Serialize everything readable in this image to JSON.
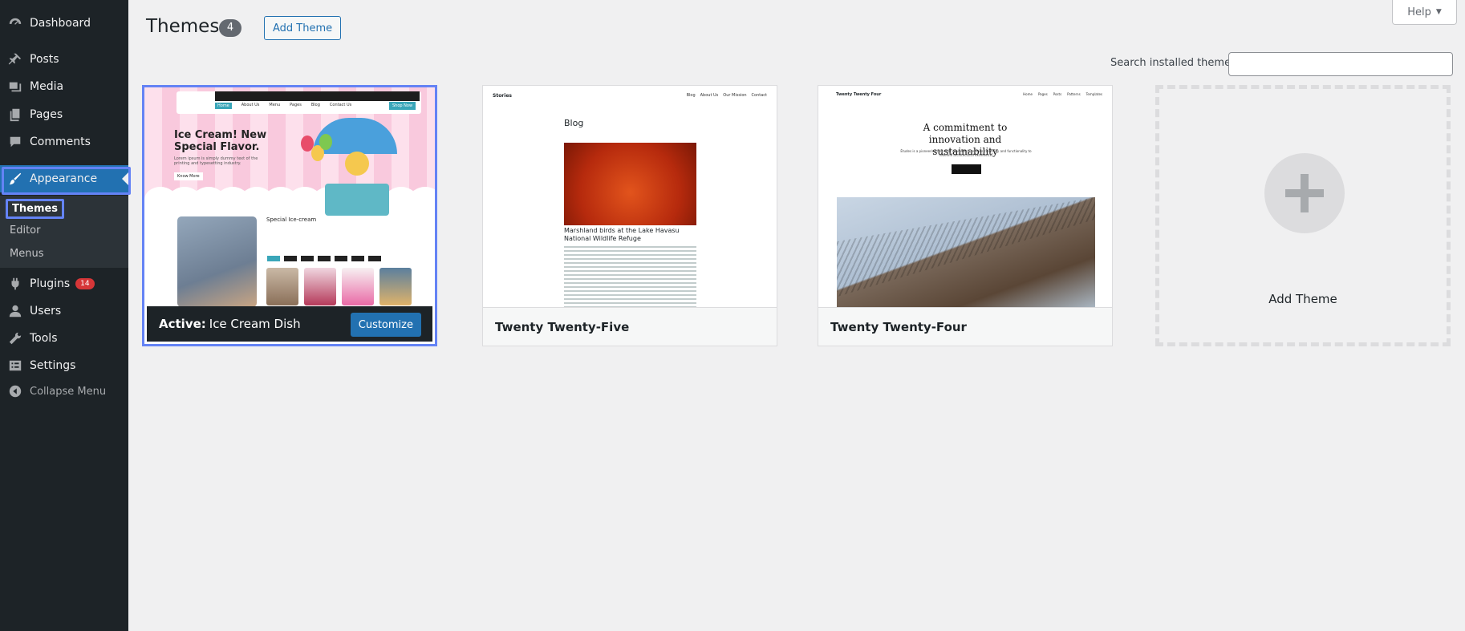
{
  "sidebar": {
    "items": [
      {
        "label": "Dashboard",
        "icon": "dashboard-icon"
      },
      {
        "label": "Posts",
        "icon": "pin-icon"
      },
      {
        "label": "Media",
        "icon": "media-icon"
      },
      {
        "label": "Pages",
        "icon": "pages-icon"
      },
      {
        "label": "Comments",
        "icon": "comment-icon"
      },
      {
        "label": "Appearance",
        "icon": "brush-icon"
      },
      {
        "label": "Plugins",
        "icon": "plugin-icon",
        "badge": "14"
      },
      {
        "label": "Users",
        "icon": "user-icon"
      },
      {
        "label": "Tools",
        "icon": "wrench-icon"
      },
      {
        "label": "Settings",
        "icon": "settings-icon"
      },
      {
        "label": "Collapse Menu",
        "icon": "collapse-icon"
      }
    ],
    "submenu": [
      "Themes",
      "Editor",
      "Menus"
    ]
  },
  "header": {
    "title": "Themes",
    "count": "4",
    "add_button": "Add Theme",
    "help": "Help",
    "search_label": "Search installed themes",
    "search_value": ""
  },
  "themes": [
    {
      "active_label": "Active:",
      "name": "Ice Cream Dish",
      "customize": "Customize",
      "preview": {
        "title": "Ice Cream! New Special Flavor.",
        "subtitle": "Lorem ipsum is simply dummy text of the printing and typesetting industry.",
        "cta": "Know More",
        "section": "Special Ice-cream",
        "nav": [
          "Home",
          "About Us",
          "Menu",
          "Pages",
          "Blog",
          "Contact Us"
        ],
        "shop": "Shop Now"
      }
    },
    {
      "name": "Twenty Twenty-Five",
      "preview": {
        "brand": "Stories",
        "nav": [
          "Blog",
          "About Us",
          "Our Mission",
          "Contact"
        ],
        "heading": "Blog",
        "caption": "Marshland birds at the Lake Havasu National Wildlife Refuge"
      }
    },
    {
      "name": "Twenty Twenty-Four",
      "preview": {
        "brand": "Twenty Twenty Four",
        "nav": [
          "Home",
          "Pages",
          "Posts",
          "Patterns",
          "Templates"
        ],
        "heading": "A commitment to innovation and sustainability",
        "text": "Études is a pioneering firm that seamlessly merges creativity and functionality to redefine architectural excellence."
      }
    }
  ],
  "add_new": {
    "label": "Add Theme"
  },
  "colors": {
    "sidebar": "#1d2327",
    "accent": "#2271b1",
    "focus": "#6483f5",
    "badge": "#d63638"
  }
}
